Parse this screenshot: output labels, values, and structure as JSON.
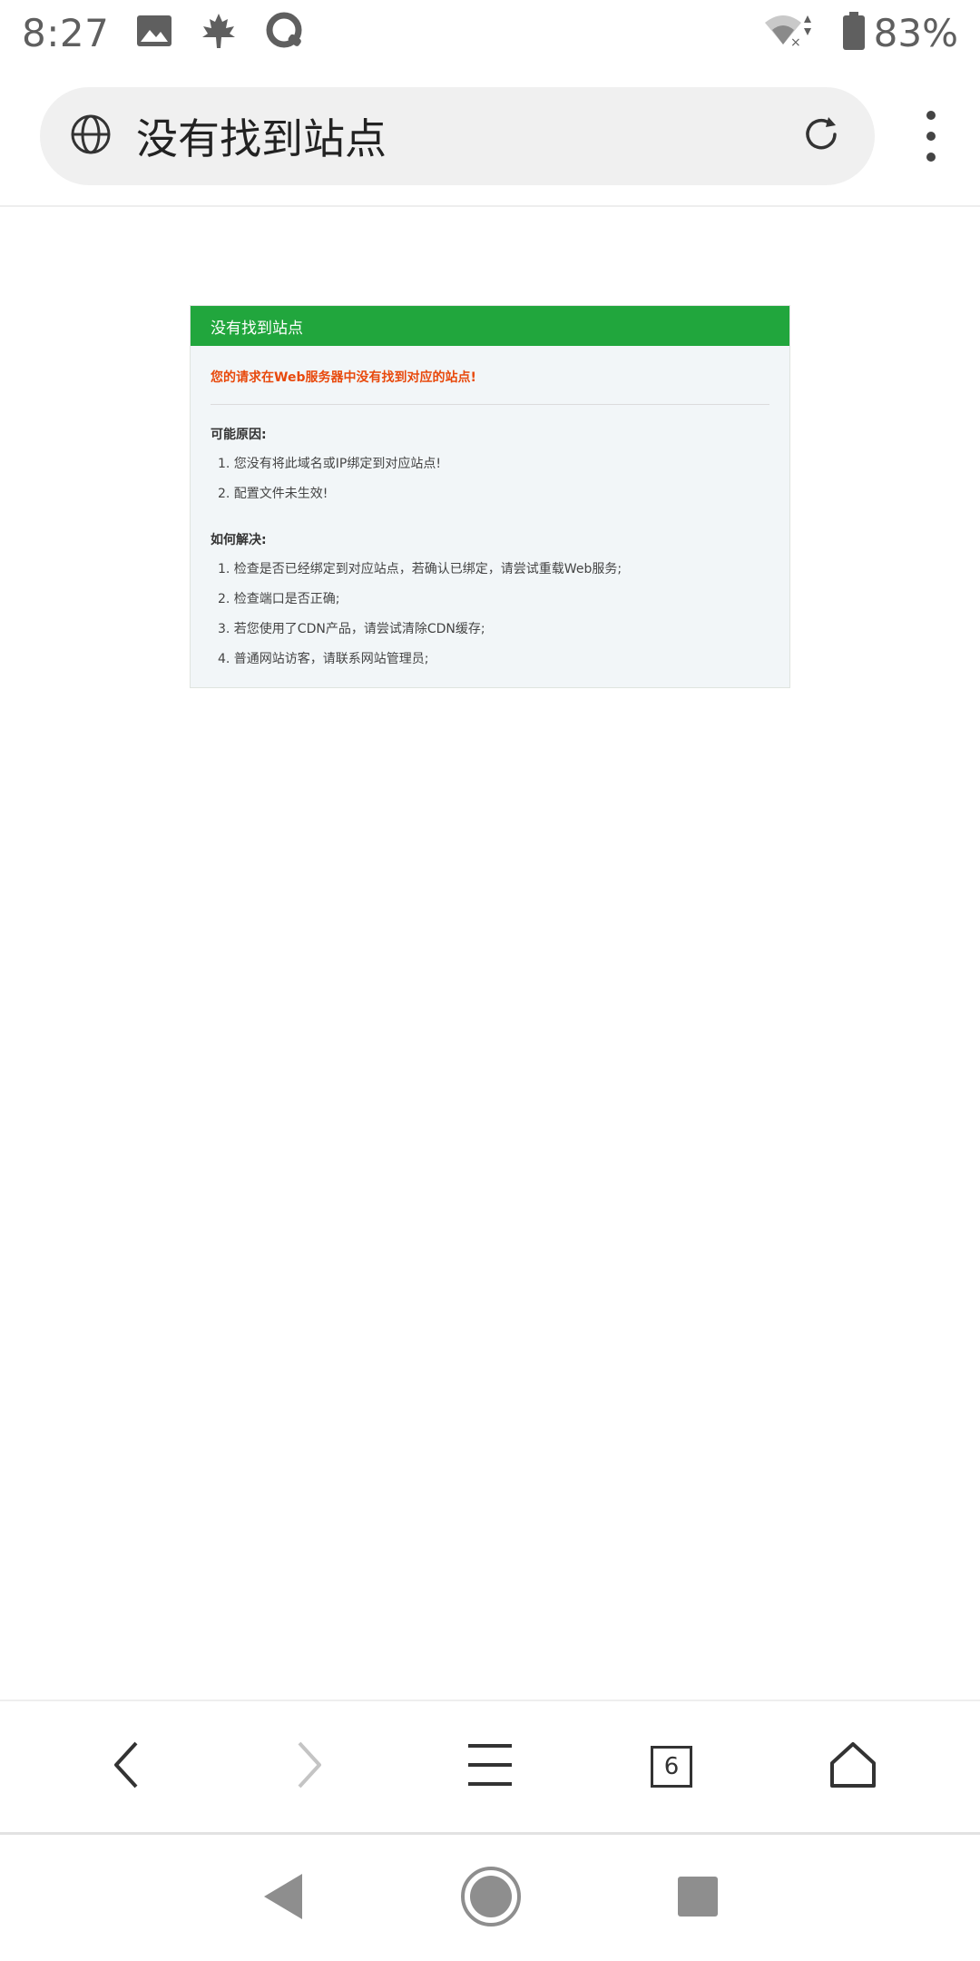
{
  "status_bar": {
    "time": "8:27",
    "battery_percent": "83%",
    "icons": [
      "image-icon",
      "maple-leaf-icon",
      "q-app-icon",
      "wifi-icon",
      "battery-icon"
    ]
  },
  "url_bar": {
    "title": "没有找到站点",
    "icons": [
      "globe-icon",
      "reload-icon",
      "more-vert-icon"
    ]
  },
  "page": {
    "header": "没有找到站点",
    "alert": "您的请求在Web服务器中没有找到对应的站点!",
    "reasons_title": "可能原因:",
    "reasons": [
      "1. 您没有将此域名或IP绑定到对应站点!",
      "2. 配置文件未生效!"
    ],
    "solutions_title": "如何解决:",
    "solutions": [
      "1. 检查是否已经绑定到对应站点，若确认已绑定，请尝试重载Web服务;",
      "2. 检查端口是否正确;",
      "3. 若您使用了CDN产品，请尝试清除CDN缓存;",
      "4. 普通网站访客，请联系网站管理员;"
    ]
  },
  "bottom_nav": {
    "tab_count": "6",
    "icons": [
      "back-icon",
      "forward-icon",
      "menu-icon",
      "tabs-icon",
      "home-icon"
    ]
  },
  "system_nav": {
    "icons": [
      "system-back-icon",
      "system-home-icon",
      "system-recents-icon"
    ]
  },
  "colors": {
    "header_green": "#21a63d",
    "alert_orange": "#e8490c",
    "card_bg": "#f2f6f8"
  }
}
